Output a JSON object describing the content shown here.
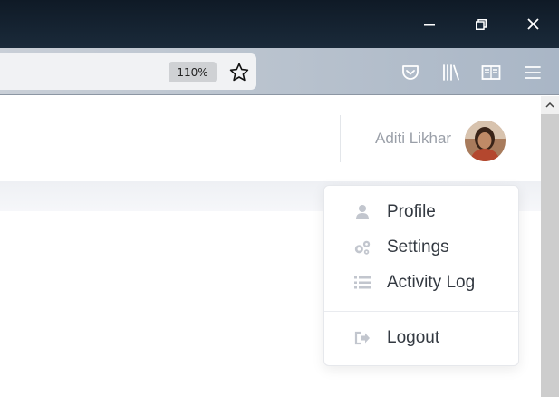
{
  "browser": {
    "zoom_level": "110%",
    "window_controls": {
      "minimize_icon": "minimize-icon",
      "maximize_icon": "restore-icon",
      "close_icon": "close-icon"
    },
    "toolbar_icons": [
      "star-icon",
      "pocket-icon",
      "library-icon",
      "reader-view-icon",
      "hamburger-menu-icon"
    ]
  },
  "header": {
    "user_name": "Aditi Likhar",
    "avatar_icon": "user-avatar"
  },
  "user_menu": {
    "items": [
      {
        "label": "Profile",
        "icon": "person-icon"
      },
      {
        "label": "Settings",
        "icon": "gears-icon"
      },
      {
        "label": "Activity Log",
        "icon": "list-icon"
      }
    ],
    "logout": {
      "label": "Logout",
      "icon": "sign-out-icon"
    }
  },
  "colors": {
    "titlebar": "#0f1a26",
    "menu_text": "#333941",
    "menu_icon": "#c2c6ce",
    "username_text": "#9a9fa8"
  }
}
